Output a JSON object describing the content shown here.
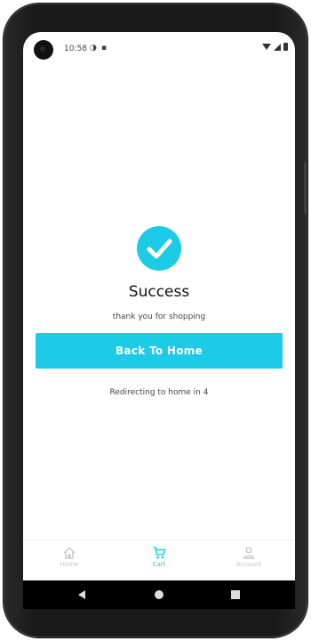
{
  "status_bar": {
    "time": "10:58"
  },
  "success": {
    "title": "Success",
    "subtitle": "thank you for shopping",
    "button_label": "Back To Home",
    "redirect_text": "Redirecting to home in 4"
  },
  "bottom_nav": {
    "items": [
      {
        "label": "Home",
        "icon": "home-icon"
      },
      {
        "label": "Cart",
        "icon": "cart-icon",
        "active": true
      },
      {
        "label": "Account",
        "icon": "account-icon"
      }
    ]
  },
  "colors": {
    "accent": "#1dcbe6",
    "inactive": "#c4c4c4"
  }
}
